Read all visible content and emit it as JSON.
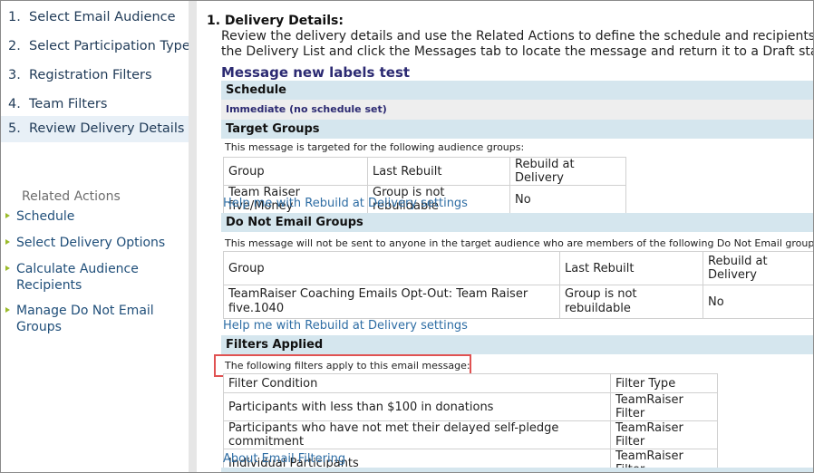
{
  "steps": [
    {
      "num": "1.",
      "label": "Select Email Audience"
    },
    {
      "num": "2.",
      "label": "Select Participation Types"
    },
    {
      "num": "3.",
      "label": "Registration Filters"
    },
    {
      "num": "4.",
      "label": "Team Filters"
    },
    {
      "num": "5.",
      "label": "Review Delivery Details"
    }
  ],
  "related_actions": {
    "title": "Related Actions",
    "items": [
      {
        "label": "Schedule"
      },
      {
        "label": "Select Delivery Options"
      },
      {
        "label": "Calculate Audience Recipients"
      },
      {
        "label": "Manage Do Not Email Groups"
      }
    ]
  },
  "main": {
    "section_title": "1. Delivery Details:",
    "intro_line1": "Review the delivery details and use the Related Actions to define the schedule and recipients of th",
    "intro_line2": "the Delivery List and click the Messages tab to locate the message and return it to a Draft state wh",
    "message_name": "Message new labels test"
  },
  "schedule": {
    "header": "Schedule",
    "value": "Immediate (no schedule set)"
  },
  "target_groups": {
    "header": "Target Groups",
    "note": "This message is targeted for the following audience groups:",
    "columns": [
      "Group",
      "Last Rebuilt",
      "Rebuild at Delivery"
    ],
    "rows": [
      [
        "Team Raiser five/Money",
        "Group is not rebuildable",
        "No"
      ]
    ],
    "help_link": "Help me with Rebuild at Delivery settings"
  },
  "do_not_email": {
    "header": "Do Not Email Groups",
    "note": "This message will not be sent to anyone in the target audience who are members of the following Do Not Email groups:",
    "columns": [
      "Group",
      "Last Rebuilt",
      "Rebuild at Delivery"
    ],
    "rows": [
      [
        "TeamRaiser Coaching Emails Opt-Out: Team Raiser five.1040",
        "Group is not rebuildable",
        "No"
      ]
    ],
    "help_link": "Help me with Rebuild at Delivery settings"
  },
  "filters": {
    "header": "Filters Applied",
    "note": "The following filters apply to this email message:",
    "columns": [
      "Filter Condition",
      "Filter Type"
    ],
    "rows": [
      [
        "Participants with less than $100 in donations",
        "TeamRaiser Filter"
      ],
      [
        "Participants who have not met their delayed self-pledge commitment",
        "TeamRaiser Filter"
      ],
      [
        "Individual Participants",
        "TeamRaiser Filter"
      ]
    ],
    "about_link": "About Email Filtering"
  },
  "colors": {
    "nav_text": "#1f3a57",
    "link": "#2e6da4",
    "section_bar": "#d5e6ee",
    "highlight_box": "#e05252",
    "message_title": "#2c2a72",
    "bullet": "#9bbb2a"
  }
}
